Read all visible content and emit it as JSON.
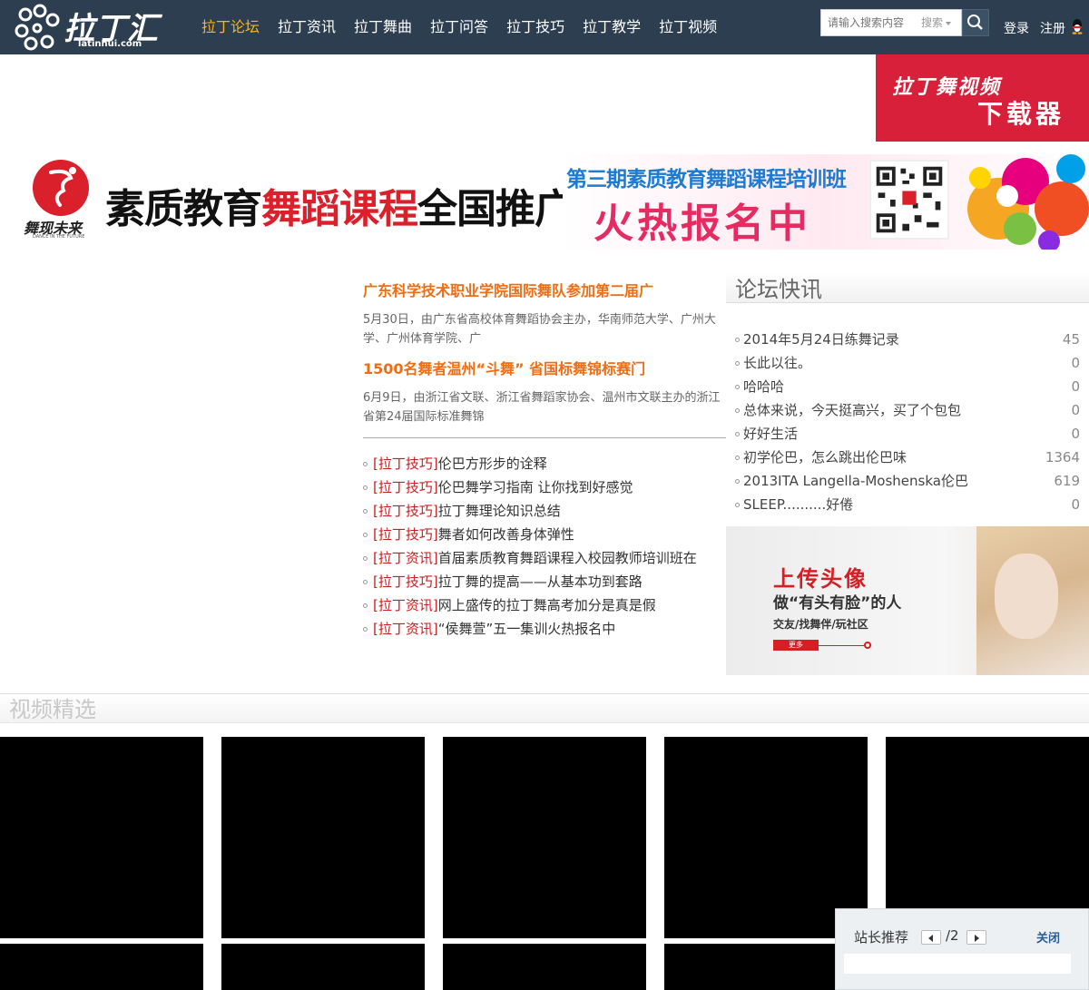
{
  "header": {
    "logo_text": "拉丁汇",
    "logo_sub": "latinhui.com",
    "nav": [
      {
        "label": "拉丁论坛",
        "active": true
      },
      {
        "label": "拉丁资讯",
        "active": false
      },
      {
        "label": "拉丁舞曲",
        "active": false
      },
      {
        "label": "拉丁问答",
        "active": false
      },
      {
        "label": "拉丁技巧",
        "active": false
      },
      {
        "label": "拉丁教学",
        "active": false
      },
      {
        "label": "拉丁视频",
        "active": false
      }
    ],
    "search": {
      "placeholder": "请输入搜索内容",
      "type_label": "搜索"
    },
    "login_label": "登录",
    "register_label": "注册"
  },
  "ads": {
    "download": {
      "line1": "拉丁舞视频",
      "line2": "下载器"
    },
    "banner": {
      "emblem_text": "舞现未来",
      "emblem_sub": "DANCE IN THE FUTURE",
      "headline_prefix": "素质教育",
      "headline_highlight": "舞蹈课程",
      "headline_suffix": "全国推广中心",
      "course": "第三期素质教育舞蹈课程培训班",
      "enroll": "火热报名中"
    },
    "avatar": {
      "line1": "上传头像",
      "line2": "做“有头有脸”的人",
      "line3": "交友/找舞伴/玩社区",
      "button": "更多"
    }
  },
  "news": {
    "headlines": [
      {
        "title": "广东科学技术职业学院国际舞队参加第二届广",
        "desc": "5月30日，由广东省高校体育舞蹈协会主办，华南师范大学、广州大学、广州体育学院、广"
      },
      {
        "title": "1500名舞者温州“斗舞” 省国标舞锦标赛门",
        "desc": "6月9日，由浙江省文联、浙江省舞蹈家协会、温州市文联主办的浙江省第24届国际标准舞锦"
      }
    ],
    "items": [
      {
        "tag": "[拉丁技巧]",
        "text": "伦巴方形步的诠释"
      },
      {
        "tag": "[拉丁技巧]",
        "text": "伦巴舞学习指南 让你找到好感觉"
      },
      {
        "tag": "[拉丁技巧]",
        "text": "拉丁舞理论知识总结"
      },
      {
        "tag": "[拉丁技巧]",
        "text": "舞者如何改善身体弹性"
      },
      {
        "tag": "[拉丁资讯]",
        "text": "首届素质教育舞蹈课程入校园教师培训班在"
      },
      {
        "tag": "[拉丁技巧]",
        "text": "拉丁舞的提高——从基本功到套路"
      },
      {
        "tag": "[拉丁资讯]",
        "text": "网上盛传的拉丁舞高考加分是真是假"
      },
      {
        "tag": "[拉丁资讯]",
        "text": "“侯舞萱”五一集训火热报名中"
      }
    ]
  },
  "forum": {
    "title": "论坛快讯",
    "items": [
      {
        "title": "2014年5月24日练舞记录",
        "count": "45"
      },
      {
        "title": "长此以往。",
        "count": "0"
      },
      {
        "title": "哈哈哈",
        "count": "0"
      },
      {
        "title": "总体来说，今天挺高兴，买了个包包",
        "count": "0"
      },
      {
        "title": "好好生活",
        "count": "0"
      },
      {
        "title": "初学伦巴，怎么跳出伦巴味",
        "count": "1364"
      },
      {
        "title": "2013ITA Langella-Moshenska伦巴",
        "count": "619"
      },
      {
        "title": "SLEEP..........好倦",
        "count": "0"
      }
    ]
  },
  "video": {
    "title": "视频精选"
  },
  "recommend": {
    "title": "站长推荐",
    "pages": "/2",
    "close_label": "关闭"
  },
  "colors": {
    "header_bg": "#2c3e50",
    "nav_active": "#f6b61a",
    "headline_orange": "#f06d12",
    "tag_red": "#c81e1e"
  }
}
